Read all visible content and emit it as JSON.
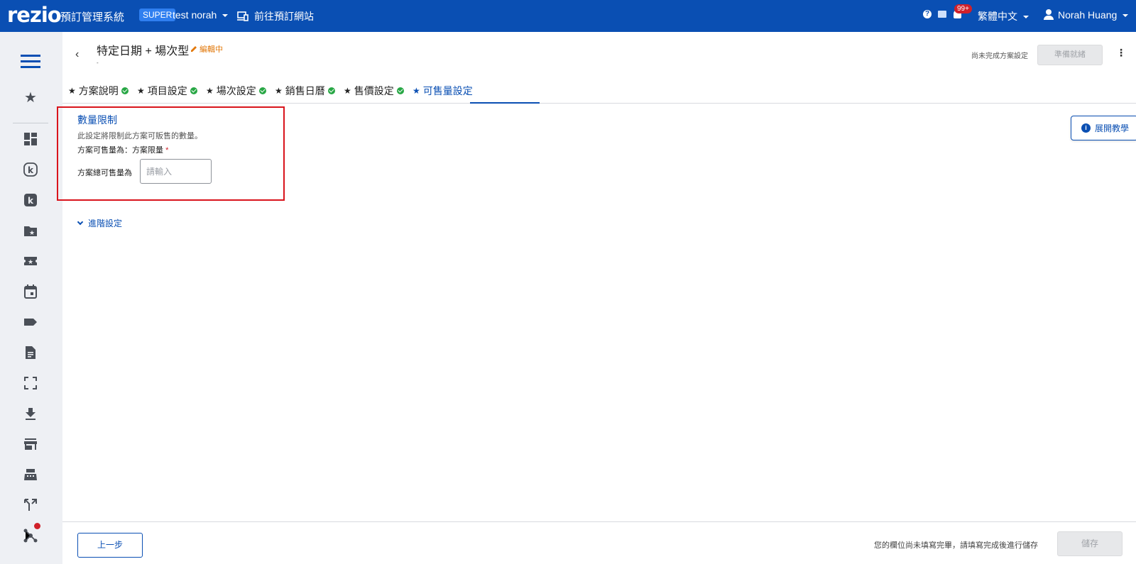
{
  "topbar": {
    "logo": "rezio",
    "system_name": "預訂管理系統",
    "role_badge": "SUPER",
    "account_name": "test norah",
    "site_link": "前往預訂網站",
    "notification_count": "99+",
    "language": "繁體中文",
    "user_name": "Norah Huang",
    "help_icon_glyph": "?"
  },
  "header": {
    "title": "特定日期 + 場次型",
    "edit_status": "編輯中",
    "subtitle": "-",
    "incomplete_text": "尚未完成方案設定",
    "ready_button": "準備就緒"
  },
  "tabs": [
    {
      "label": "方案說明",
      "complete": true
    },
    {
      "label": "項目設定",
      "complete": true
    },
    {
      "label": "場次設定",
      "complete": true
    },
    {
      "label": "銷售日曆",
      "complete": true
    },
    {
      "label": "售價設定",
      "complete": true
    },
    {
      "label": "可售量設定",
      "complete": false,
      "active": true
    }
  ],
  "quantity": {
    "section_title": "數量限制",
    "description": "此設定將限制此方案可販售的數量。",
    "saleable_label": "方案可售量為：方案限量",
    "required_mark": "*",
    "total_label": "方案總可售量為",
    "total_placeholder": "請輸入",
    "total_value": "",
    "advanced_label": "進階設定"
  },
  "tutorial_button": "展開教學",
  "footer": {
    "prev_button": "上一步",
    "message": "您的欄位尚未填寫完畢，請填寫完成後進行儲存",
    "save_button": "儲存"
  },
  "sidebar_icons": [
    "menu-icon",
    "star-icon",
    "dashboard-icon",
    "k-outline-icon",
    "k-filled-icon",
    "folder-star-icon",
    "ticket-star-icon",
    "calendar-icon",
    "tag-icon",
    "document-icon",
    "scan-icon",
    "download-icon",
    "store-icon",
    "cashier-icon",
    "merge-icon",
    "network-icon"
  ],
  "colors": {
    "brand_blue": "#0a4fb3",
    "highlight_red": "#d9141c",
    "success_green": "#28a745",
    "edit_orange": "#e2780a"
  }
}
